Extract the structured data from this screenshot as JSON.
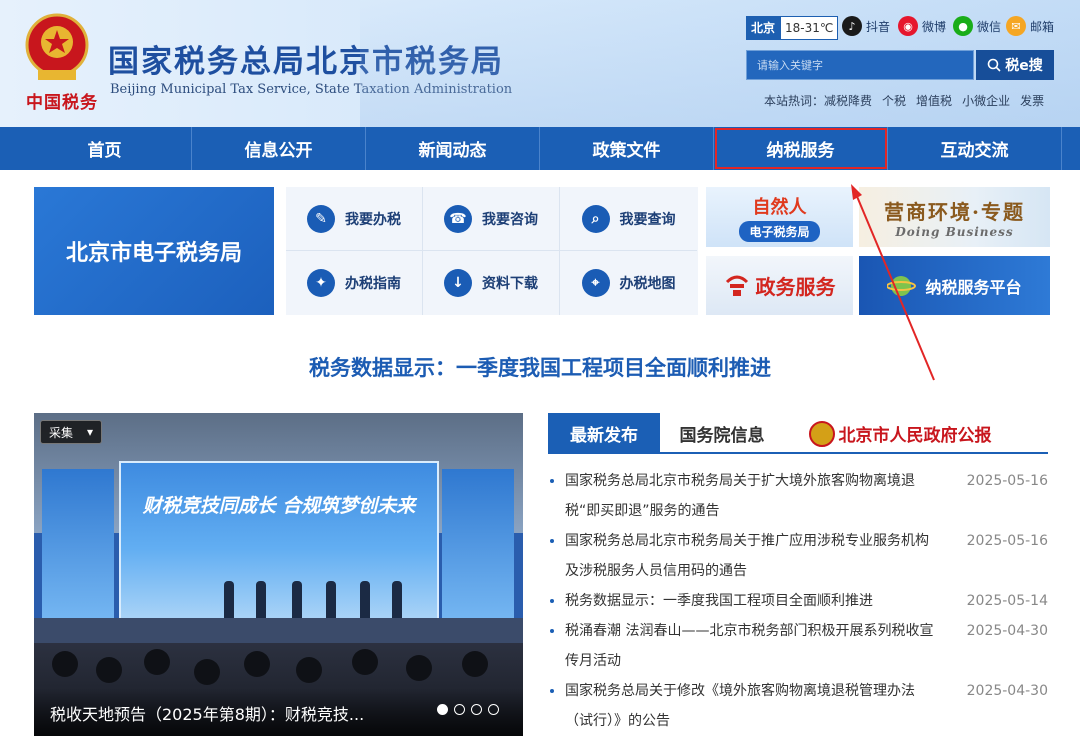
{
  "header": {
    "slogan": "中国税务",
    "title": "国家税务总局北京市税务局",
    "subtitle": "Beijing Municipal Tax Service, State Taxation Administration",
    "weather": {
      "city": "北京",
      "temp": "18-31℃"
    },
    "social": [
      {
        "label": "抖音",
        "icon": "douyin-icon",
        "color": "#1a1a1a"
      },
      {
        "label": "微博",
        "icon": "weibo-icon",
        "color": "#e6162d"
      },
      {
        "label": "微信",
        "icon": "wechat-icon",
        "color": "#1aad19"
      },
      {
        "label": "邮箱",
        "icon": "mail-icon",
        "color": "#f5a623"
      }
    ],
    "search": {
      "placeholder": "请输入关键字",
      "button": "税e搜"
    },
    "hot": {
      "prefix": "本站热词：",
      "words": [
        "减税降费",
        "个税",
        "增值税",
        "小微企业",
        "发票"
      ]
    }
  },
  "nav": [
    "首页",
    "信息公开",
    "新闻动态",
    "政策文件",
    "纳税服务",
    "互动交流"
  ],
  "nav_active": "纳税服务",
  "etax": "北京市电子税务局",
  "services": [
    {
      "label": "我要办税",
      "icon": "tax-handling-icon",
      "glyph": "✎"
    },
    {
      "label": "我要咨询",
      "icon": "headset-icon",
      "glyph": "☎"
    },
    {
      "label": "我要查询",
      "icon": "search-doc-icon",
      "glyph": "⌕"
    },
    {
      "label": "办税指南",
      "icon": "compass-icon",
      "glyph": "✦"
    },
    {
      "label": "资料下载",
      "icon": "download-icon",
      "glyph": "↓"
    },
    {
      "label": "办税地图",
      "icon": "map-pin-icon",
      "glyph": "⌖"
    }
  ],
  "banners": {
    "b1_title": "自然人",
    "b1_sub": "电子税务局",
    "b2_title": "营商环境·专题",
    "b2_sub": "Doing Business",
    "b3_title": "政务服务",
    "b4_title": "纳税服务平台"
  },
  "headline": "税务数据显示：一季度我国工程项目全面顺利推进",
  "carousel": {
    "tag": "采集",
    "screen_text": "财税竞技同成长 合规筑梦创未来",
    "caption": "税收天地预告（2025年第8期）：财税竞技...",
    "slides": 4,
    "current": 1
  },
  "tabs": {
    "active": "最新发布",
    "second": "国务院信息",
    "third": "北京市人民政府公报"
  },
  "news": [
    {
      "title": "国家税务总局北京市税务局关于扩大境外旅客购物离境退税“即买即退”服务的通告",
      "date": "2025-05-16"
    },
    {
      "title": "国家税务总局北京市税务局关于推广应用涉税专业服务机构及涉税服务人员信用码的通告",
      "date": "2025-05-16"
    },
    {
      "title": "税务数据显示：一季度我国工程项目全面顺利推进",
      "date": "2025-05-14"
    },
    {
      "title": "税涌春潮 法润春山——北京市税务部门积极开展系列税收宣传月活动",
      "date": "2025-04-30"
    },
    {
      "title": "国家税务总局关于修改《境外旅客购物离境退税管理办法（试行）》的公告",
      "date": "2025-04-30"
    }
  ]
}
